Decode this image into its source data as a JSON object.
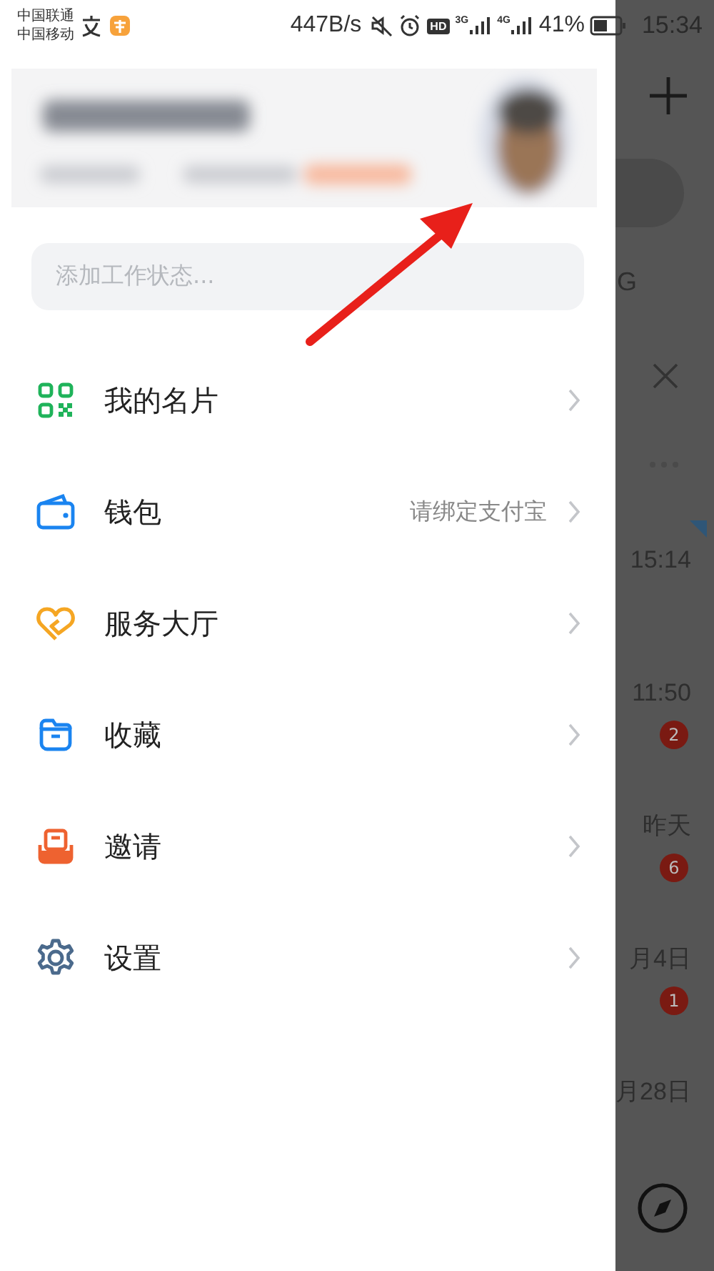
{
  "status_bar": {
    "carriers": [
      "中国联通",
      "中国移动"
    ],
    "speed": "447B/s",
    "hd": "HD",
    "networks": [
      "3G",
      "4G"
    ],
    "battery": "41%",
    "time": "15:34"
  },
  "drawer": {
    "status_placeholder": "添加工作状态...",
    "menu": [
      {
        "label": "我的名片"
      },
      {
        "label": "钱包",
        "detail": "请绑定支付宝"
      },
      {
        "label": "服务大厅"
      },
      {
        "label": "收藏"
      },
      {
        "label": "邀请"
      },
      {
        "label": "设置"
      }
    ]
  },
  "background": {
    "fragment": "G",
    "chats": [
      {
        "time": "15:14"
      },
      {
        "time": "11:50",
        "badge": "2"
      },
      {
        "time": "昨天",
        "badge": "6"
      },
      {
        "time": "月4日",
        "badge": "1"
      },
      {
        "time": "月28日"
      }
    ]
  }
}
